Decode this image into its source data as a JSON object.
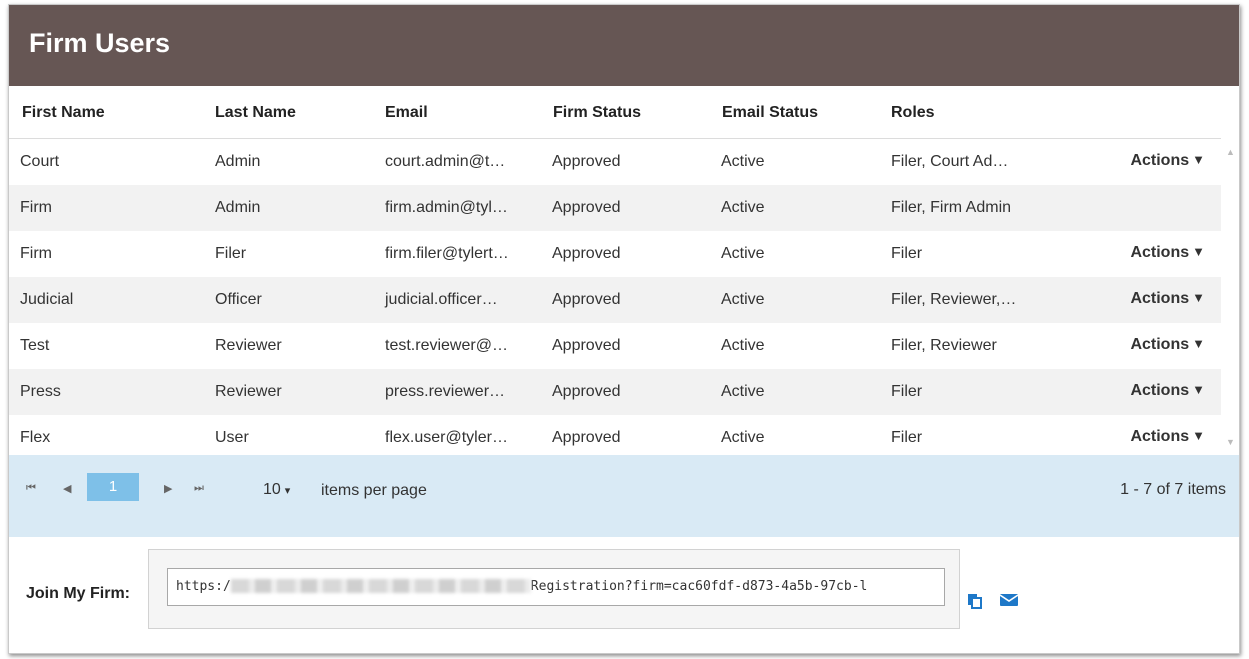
{
  "header": {
    "title": "Firm Users"
  },
  "columns": [
    "First Name",
    "Last Name",
    "Email",
    "Firm Status",
    "Email Status",
    "Roles"
  ],
  "rows": [
    {
      "first": "Court",
      "last": "Admin",
      "email": "court.admin@t…",
      "firm_status": "Approved",
      "email_status": "Active",
      "roles": "Filer, Court Ad…",
      "actions": "Actions"
    },
    {
      "first": "Firm",
      "last": "Admin",
      "email": "firm.admin@tyl…",
      "firm_status": "Approved",
      "email_status": "Active",
      "roles": "Filer, Firm Admin",
      "actions": ""
    },
    {
      "first": "Firm",
      "last": "Filer",
      "email": "firm.filer@tylert…",
      "firm_status": "Approved",
      "email_status": "Active",
      "roles": "Filer",
      "actions": "Actions"
    },
    {
      "first": "Judicial",
      "last": "Officer",
      "email": "judicial.officer…",
      "firm_status": "Approved",
      "email_status": "Active",
      "roles": "Filer, Reviewer,…",
      "actions": "Actions"
    },
    {
      "first": "Test",
      "last": "Reviewer",
      "email": "test.reviewer@…",
      "firm_status": "Approved",
      "email_status": "Active",
      "roles": "Filer, Reviewer",
      "actions": "Actions"
    },
    {
      "first": "Press",
      "last": "Reviewer",
      "email": "press.reviewer…",
      "firm_status": "Approved",
      "email_status": "Active",
      "roles": "Filer",
      "actions": "Actions"
    },
    {
      "first": "Flex",
      "last": "User",
      "email": "flex.user@tyler…",
      "firm_status": "Approved",
      "email_status": "Active",
      "roles": "Filer",
      "actions": "Actions"
    }
  ],
  "actions_caret": "▼",
  "pager": {
    "first_icon": "⏮",
    "prev_icon": "◀",
    "current_page": "1",
    "next_icon": "▶",
    "last_icon": "⏭",
    "per_page_value": "10",
    "per_page_caret": "▾",
    "per_page_label": "items per page",
    "info": "1 - 7 of 7 items"
  },
  "join": {
    "label": "Join My Firm:",
    "url_prefix": "https:/",
    "url_suffix": "Registration?firm=cac60fdf-d873-4a5b-97cb-l",
    "copy_icon": "copy-icon",
    "email_icon": "envelope-icon"
  },
  "colors": {
    "header_bg": "#665654",
    "pager_bg": "#d9eaf5",
    "page_active": "#7ec0e8",
    "icon_blue": "#1e78c8"
  }
}
